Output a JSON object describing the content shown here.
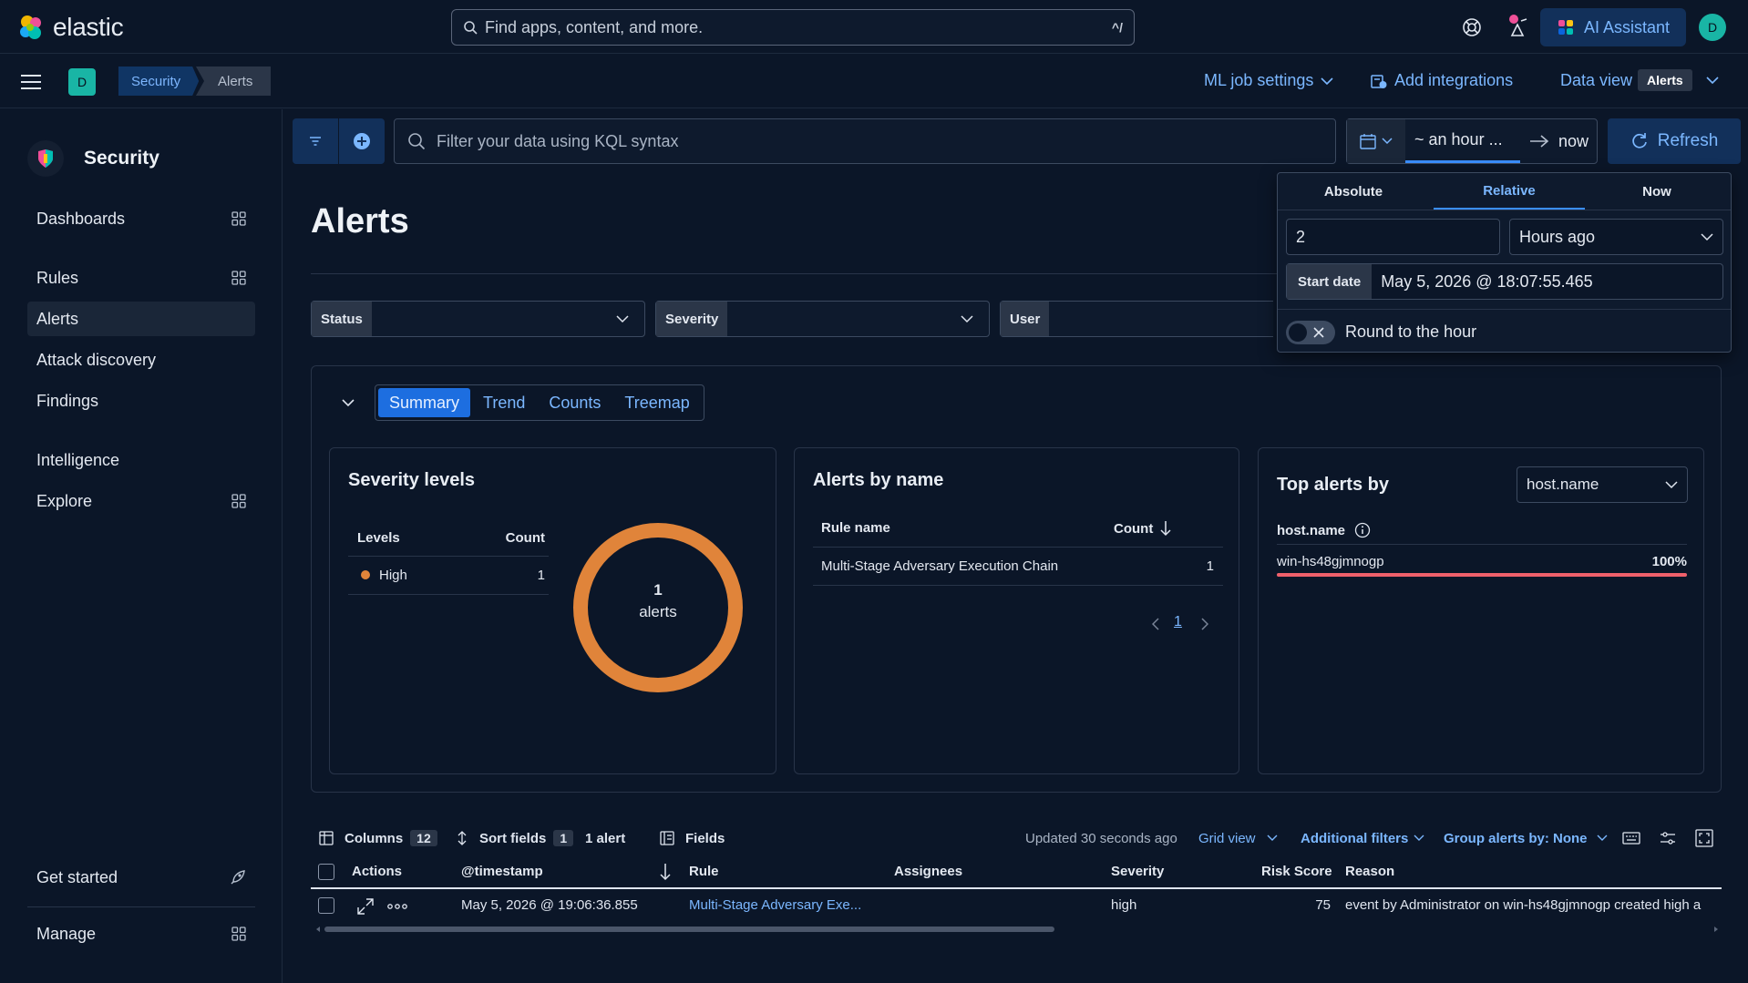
{
  "brand": {
    "name": "elastic"
  },
  "header": {
    "search_placeholder": "Find apps, content, and more.",
    "search_shortcut": "^/",
    "ai_assistant_label": "AI Assistant",
    "avatar_initial": "D"
  },
  "subheader": {
    "space_initial": "D",
    "breadcrumbs": [
      "Security",
      "Alerts"
    ],
    "ml_job_settings": "ML job settings",
    "add_integrations": "Add integrations",
    "data_view_label": "Data view",
    "data_view_value": "Alerts"
  },
  "sidebar": {
    "title": "Security",
    "items": [
      {
        "label": "Dashboards"
      },
      {
        "label": "Rules"
      },
      {
        "label": "Alerts"
      },
      {
        "label": "Attack discovery"
      },
      {
        "label": "Findings"
      },
      {
        "label": "Intelligence"
      },
      {
        "label": "Explore"
      },
      {
        "label": "Get started"
      },
      {
        "label": "Manage"
      }
    ]
  },
  "querybar": {
    "kql_placeholder": "Filter your data using KQL syntax",
    "start": "~ an hour ...",
    "end": "now",
    "refresh_label": "Refresh"
  },
  "datepicker_popover": {
    "tabs": [
      "Absolute",
      "Relative",
      "Now"
    ],
    "selected_tab": "Relative",
    "amount": "2",
    "unit": "Hours ago",
    "start_date_label": "Start date",
    "start_date_value": "May 5, 2026 @ 18:07:55.465",
    "round_label": "Round to the hour"
  },
  "page": {
    "title": "Alerts",
    "filters": [
      {
        "label": "Status"
      },
      {
        "label": "Severity"
      },
      {
        "label": "User"
      }
    ]
  },
  "summary": {
    "tabs": [
      "Summary",
      "Trend",
      "Counts",
      "Treemap"
    ],
    "selected_tab": "Summary",
    "severity": {
      "title": "Severity levels",
      "col_levels": "Levels",
      "col_count": "Count",
      "rows": [
        {
          "level": "High",
          "count": "1"
        }
      ],
      "donut_count": "1",
      "donut_label": "alerts",
      "colors": {
        "high": "#e0843a"
      }
    },
    "by_name": {
      "title": "Alerts by name",
      "col_rule": "Rule name",
      "col_count": "Count",
      "rows": [
        {
          "rule": "Multi-Stage Adversary Execution Chain",
          "count": "1"
        }
      ],
      "page": "1"
    },
    "top_alerts": {
      "title": "Top alerts by",
      "field_select": "host.name",
      "field_label": "host.name",
      "rows": [
        {
          "name": "win-hs48gjmnogp",
          "pct": "100%",
          "fraction": 1.0
        }
      ]
    }
  },
  "table_toolbar": {
    "columns_label": "Columns",
    "columns_count": "12",
    "sort_label": "Sort fields",
    "sort_count": "1",
    "alert_count": "1 alert",
    "fields_label": "Fields",
    "updated": "Updated 30 seconds ago",
    "grid_view": "Grid view",
    "additional_filters": "Additional filters",
    "group_by": "Group alerts by: None"
  },
  "table": {
    "headers": [
      "Actions",
      "@timestamp",
      "Rule",
      "Assignees",
      "Severity",
      "Risk Score",
      "Reason"
    ],
    "rows": [
      {
        "timestamp": "May 5, 2026 @ 19:06:36.855",
        "rule": "Multi-Stage Adversary Exe...",
        "assignees": "",
        "severity": "high",
        "risk_score": "75",
        "reason": "event by Administrator on win-hs48gjmnogp created high a"
      }
    ]
  }
}
